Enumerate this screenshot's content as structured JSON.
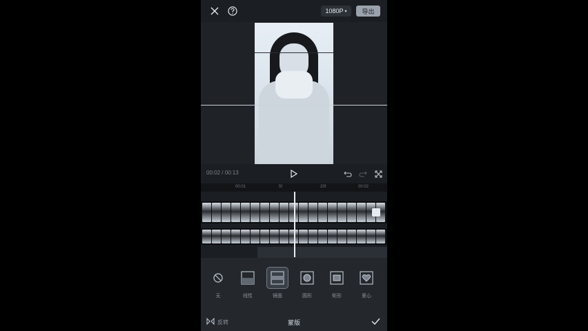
{
  "toolbar": {
    "resolution": "1080P",
    "export_label": "导出",
    "close_icon": "close-icon",
    "help_icon": "help-icon"
  },
  "player": {
    "current_time": "00:02",
    "separator": "/",
    "total_time": "00:13"
  },
  "timeline": {
    "ticks": [
      "00:01",
      "5f",
      "20f",
      "00:02"
    ]
  },
  "masks": [
    {
      "label": "无",
      "icon": "none-icon"
    },
    {
      "label": "线性",
      "icon": "linear-mask-icon"
    },
    {
      "label": "镜面",
      "icon": "mirror-mask-icon"
    },
    {
      "label": "圆形",
      "icon": "circle-mask-icon"
    },
    {
      "label": "矩形",
      "icon": "rectangle-mask-icon"
    },
    {
      "label": "爱心",
      "icon": "heart-mask-icon"
    }
  ],
  "footer": {
    "invert_label": "反转",
    "title": "蒙版"
  },
  "colors": {
    "background": "#1b1e22",
    "panel": "#24282d",
    "accent": "#e6ebf2"
  }
}
